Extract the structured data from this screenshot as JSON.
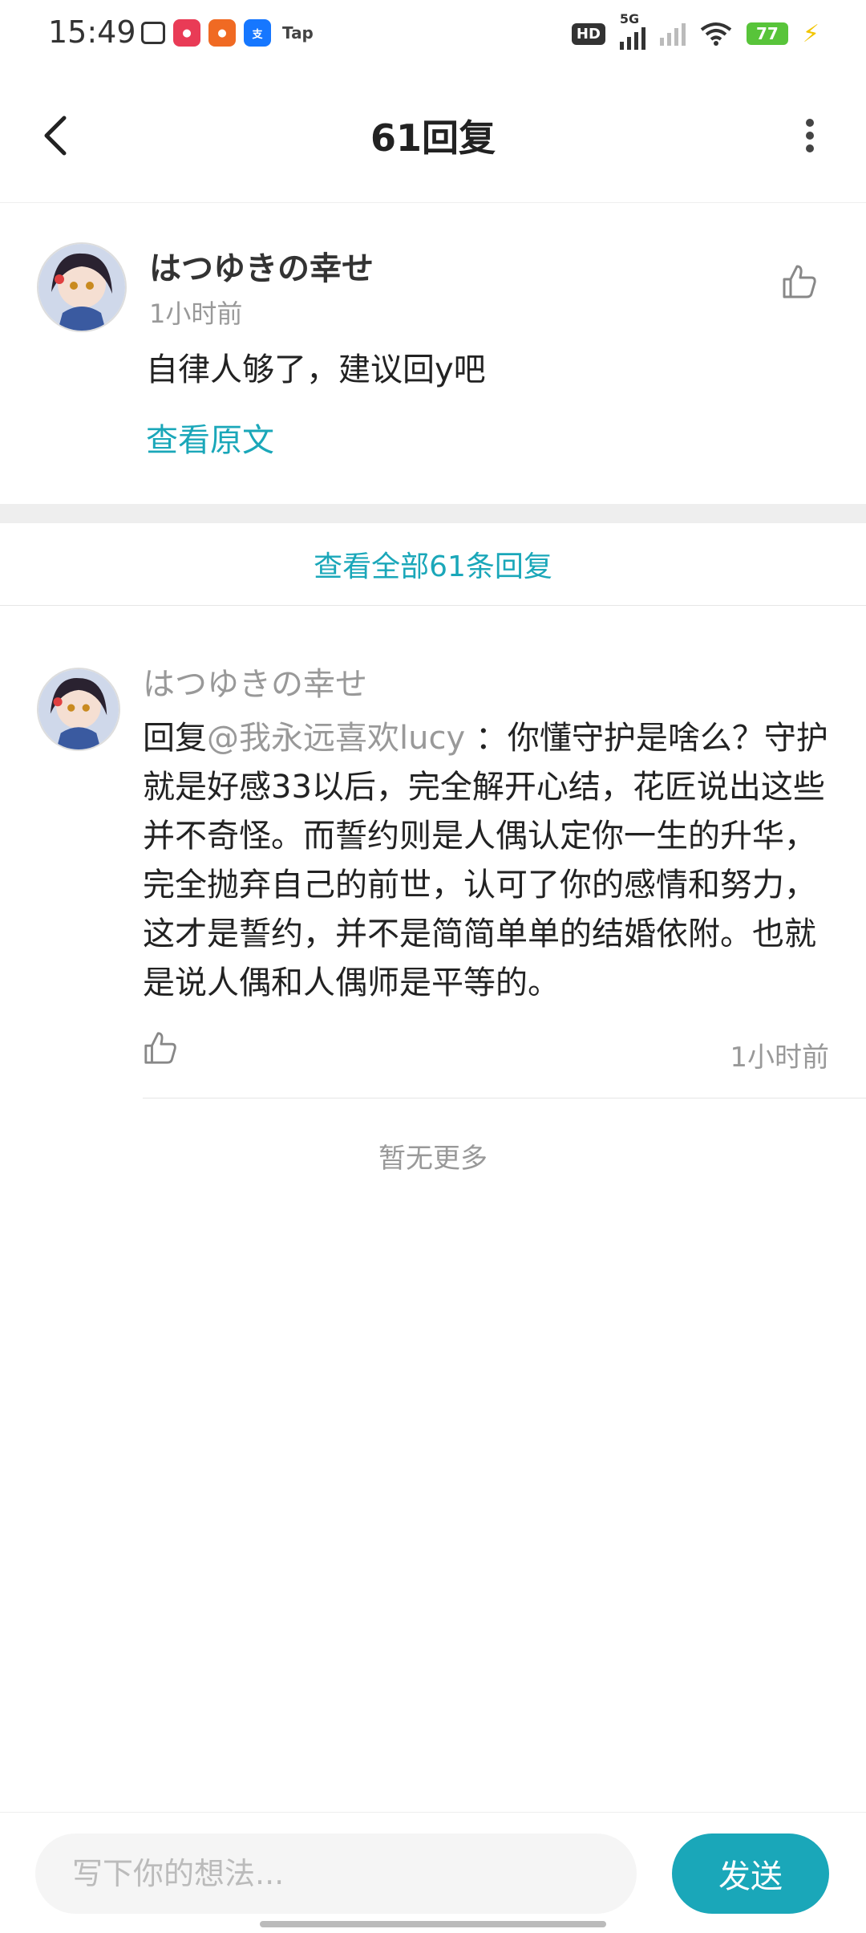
{
  "status_bar": {
    "time": "15:49",
    "tap_label": "Tap",
    "hd_label": "HD",
    "network_label": "5G",
    "battery": "77"
  },
  "header": {
    "title": "61回复"
  },
  "original_comment": {
    "username": "はつゆきの幸せ",
    "time": "1小时前",
    "content": "自律人够了，建议回y吧",
    "view_original": "查看原文"
  },
  "view_all_replies": "查看全部61条回复",
  "reply": {
    "username": "はつゆきの幸せ",
    "prefix": "回复",
    "mention": "@我永远喜欢lucy",
    "text": " ：你懂守护是啥么？守护就是好感33以后，完全解开心结，花匠说出这些并不奇怪。而誓约则是人偶认定你一生的升华，完全抛弃自己的前世，认可了你的感情和努力，这才是誓约，并不是简简单单的结婚依附。也就是说人偶和人偶师是平等的。",
    "time": "1小时前"
  },
  "no_more": "暂无更多",
  "composer": {
    "placeholder": "写下你的想法...",
    "send_label": "发送"
  },
  "colors": {
    "accent": "#1aa7b9",
    "muted": "#999999"
  }
}
